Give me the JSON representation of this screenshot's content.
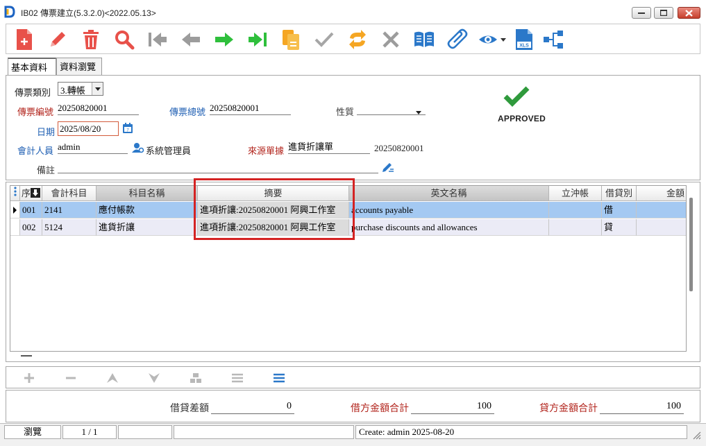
{
  "window": {
    "title": "IB02 傳票建立(5.3.2.0)<2022.05.13>"
  },
  "toolbar": {
    "buttons": [
      "new",
      "edit",
      "delete",
      "search",
      "first",
      "previous",
      "next",
      "last",
      "copy",
      "confirm",
      "refresh",
      "cancel",
      "view-book",
      "attach",
      "preview",
      "export-xls",
      "flow"
    ]
  },
  "tabs": [
    {
      "label": "基本資料",
      "active": true
    },
    {
      "label": "資料瀏覽",
      "active": false
    }
  ],
  "form": {
    "voucher_type_label": "傳票類別",
    "voucher_type_value": "3.轉帳",
    "voucher_no_label": "傳票編號",
    "voucher_no_value": "20250820001",
    "voucher_total_no_label": "傳票總號",
    "voucher_total_no_value": "20250820001",
    "nature_label": "性質",
    "nature_value": "",
    "date_label": "日期",
    "date_value": "2025/08/20",
    "accountant_label": "會計人員",
    "accountant_value": "admin",
    "accountant_name": "系統管理員",
    "source_label": "來源單據",
    "source_value": "進貨折讓單",
    "source_no": "20250820001",
    "remark_label": "備註",
    "remark_value": "",
    "status_text": "APPROVED"
  },
  "grid": {
    "headers": {
      "seq": "序",
      "account_code": "會計科目",
      "account_name": "科目名稱",
      "summary": "摘要",
      "english_name": "英文名稱",
      "offset": "立沖帳",
      "dc": "借貸別",
      "amount": "金額"
    },
    "rows": [
      {
        "seq": "001",
        "account_code": "2141",
        "account_name": "應付帳款",
        "summary": "進項折讓:20250820001 阿興工作室",
        "english_name": "accounts payable",
        "offset": "",
        "dc": "借",
        "amount": ""
      },
      {
        "seq": "002",
        "account_code": "5124",
        "account_name": "進貨折讓",
        "summary": "進項折讓:20250820001 阿興工作室",
        "english_name": "purchase discounts and allowances",
        "offset": "",
        "dc": "貸",
        "amount": ""
      }
    ]
  },
  "totals": {
    "difference_label": "借貸差額",
    "difference_value": "0",
    "debit_total_label": "借方金額合計",
    "debit_total_value": "100",
    "credit_total_label": "貸方金額合計",
    "credit_total_value": "100"
  },
  "statusbar": {
    "mode": "瀏覽",
    "page": "1 / 1",
    "create_info": "Create: admin 2025-08-20"
  },
  "colors": {
    "label_red": "#b2241c",
    "label_blue": "#1f5fb3",
    "row_selected": "#a4c9f2",
    "highlight": "#d42323",
    "approved_check": "#2f9a3c"
  }
}
